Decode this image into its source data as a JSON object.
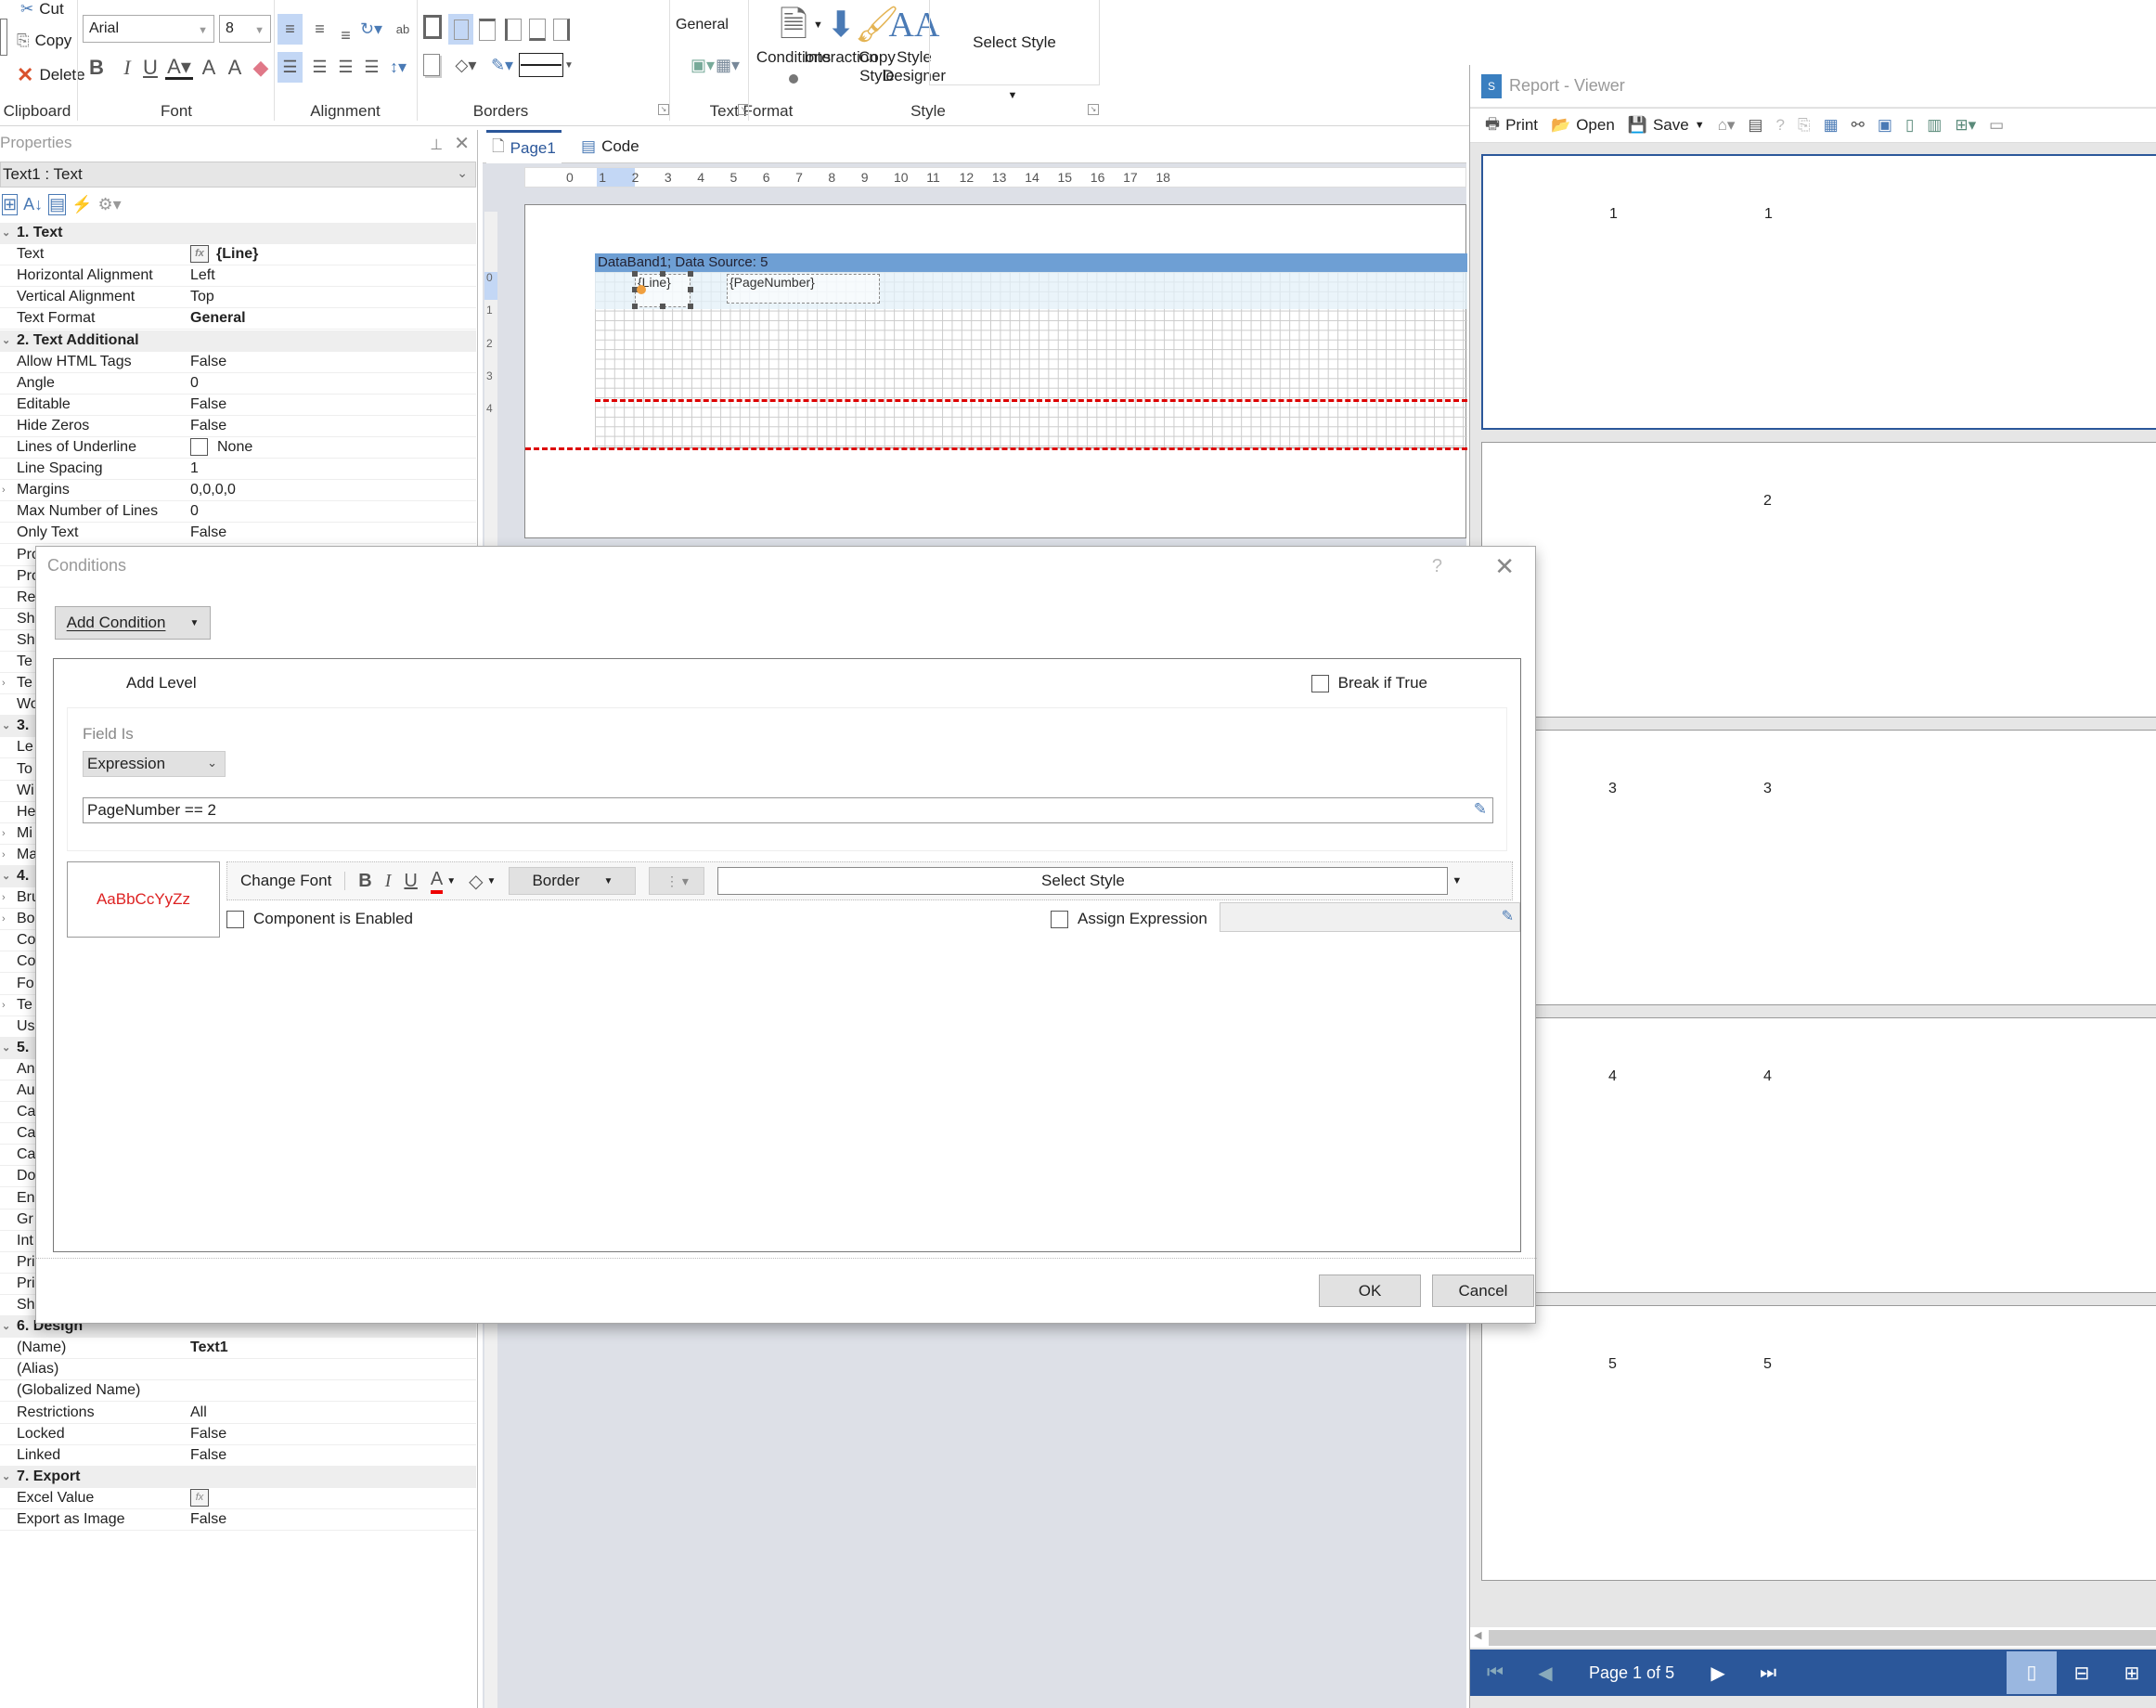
{
  "ribbon": {
    "clipboard": {
      "label": "Clipboard",
      "cut": "Cut",
      "copy": "Copy",
      "delete": "Delete"
    },
    "font": {
      "label": "Font",
      "family": "Arial",
      "size": "8"
    },
    "alignment": {
      "label": "Alignment"
    },
    "borders": {
      "label": "Borders"
    },
    "text_format": {
      "label": "Text Format",
      "value": "General"
    },
    "style": {
      "label": "Style",
      "conditions": "Conditions",
      "interaction": "Interaction",
      "copy_style": "Copy Style",
      "style_designer": "Style Designer",
      "select_style": "Select Style"
    }
  },
  "properties": {
    "title": "Properties",
    "object": "Text1 : Text",
    "rows_top": [
      {
        "type": "cat",
        "k": "1. Text"
      },
      {
        "k": "Text",
        "v": "{Line}",
        "fx": true,
        "bold": true
      },
      {
        "k": "Horizontal Alignment",
        "v": "Left"
      },
      {
        "k": "Vertical Alignment",
        "v": "Top"
      },
      {
        "k": "Text Format",
        "v": "General",
        "bold": true
      },
      {
        "type": "cat",
        "k": "2. Text  Additional"
      },
      {
        "k": "Allow HTML Tags",
        "v": "False"
      },
      {
        "k": "Angle",
        "v": "0"
      },
      {
        "k": "Editable",
        "v": "False"
      },
      {
        "k": "Hide Zeros",
        "v": "False"
      },
      {
        "k": "Lines of Underline",
        "v": "None",
        "check": true
      },
      {
        "k": "Line Spacing",
        "v": "1"
      },
      {
        "k": "Margins",
        "v": "0,0,0,0",
        "exp": true
      },
      {
        "k": "Max Number of Lines",
        "v": "0"
      },
      {
        "k": "Only Text",
        "v": "False"
      },
      {
        "k": "Pro",
        "v": ""
      },
      {
        "k": "Pro",
        "v": ""
      },
      {
        "k": "Re",
        "v": ""
      },
      {
        "k": "Sh",
        "v": ""
      },
      {
        "k": "Sh",
        "v": ""
      },
      {
        "k": "Te",
        "v": ""
      },
      {
        "k": "Te",
        "v": "",
        "exp": true
      },
      {
        "k": "Wo",
        "v": ""
      },
      {
        "type": "cat",
        "k": "3."
      },
      {
        "k": "Le",
        "v": ""
      },
      {
        "k": "To",
        "v": ""
      },
      {
        "k": "Wi",
        "v": ""
      },
      {
        "k": "He",
        "v": ""
      },
      {
        "k": "Mi",
        "v": "",
        "exp": true
      },
      {
        "k": "Ma",
        "v": "",
        "exp": true
      },
      {
        "type": "cat",
        "k": "4."
      },
      {
        "k": "Bru",
        "v": "",
        "exp": true
      },
      {
        "k": "Bo",
        "v": "",
        "exp": true
      },
      {
        "k": "Co",
        "v": ""
      },
      {
        "k": "Co",
        "v": ""
      },
      {
        "k": "Fo",
        "v": ""
      },
      {
        "k": "Te",
        "v": "",
        "exp": true
      },
      {
        "k": "Us",
        "v": ""
      },
      {
        "type": "cat",
        "k": "5."
      },
      {
        "k": "An",
        "v": ""
      },
      {
        "k": "Au",
        "v": ""
      },
      {
        "k": "Ca",
        "v": ""
      },
      {
        "k": "Ca",
        "v": ""
      },
      {
        "k": "Ca",
        "v": ""
      },
      {
        "k": "Do",
        "v": ""
      },
      {
        "k": "En",
        "v": ""
      },
      {
        "k": "Gr",
        "v": ""
      },
      {
        "k": "Int",
        "v": ""
      },
      {
        "k": "Pri",
        "v": ""
      },
      {
        "k": "Pri",
        "v": ""
      },
      {
        "k": "Sh",
        "v": ""
      },
      {
        "type": "cat",
        "k": "6. Design"
      },
      {
        "k": "(Name)",
        "v": "Text1",
        "bold": true
      },
      {
        "k": "(Alias)",
        "v": ""
      },
      {
        "k": "(Globalized Name)",
        "v": ""
      },
      {
        "k": "Restrictions",
        "v": "All"
      },
      {
        "k": "Locked",
        "v": "False"
      },
      {
        "k": "Linked",
        "v": "False"
      },
      {
        "type": "cat",
        "k": "7. Export"
      },
      {
        "k": "Excel Value",
        "v": "",
        "fx": true
      },
      {
        "k": "Export as Image",
        "v": "False"
      }
    ]
  },
  "designer": {
    "tabs": [
      {
        "label": "Page1"
      },
      {
        "label": "Code"
      }
    ],
    "ruler": [
      "0",
      "1",
      "2",
      "3",
      "4",
      "5",
      "6",
      "7",
      "8",
      "9",
      "10",
      "11",
      "12",
      "13",
      "14",
      "15",
      "16",
      "17",
      "18"
    ],
    "vruler": [
      "0",
      "1",
      "2",
      "3",
      "4"
    ],
    "band_title": "DataBand1; Data Source: 5",
    "comp_line": "{Line}",
    "comp_page": "{PageNumber}"
  },
  "viewer": {
    "title": "Report - Viewer",
    "toolbar": {
      "print": "Print",
      "open": "Open",
      "save": "Save"
    },
    "pages": [
      {
        "line": "1",
        "page": "1"
      },
      {
        "line": "",
        "page": "2"
      },
      {
        "line": "3",
        "page": "3"
      },
      {
        "line": "4",
        "page": "4"
      },
      {
        "line": "5",
        "page": "5"
      }
    ],
    "page_info": "Page 1 of 5"
  },
  "dialog": {
    "title": "Conditions",
    "help": "?",
    "add_condition": "Add Condition",
    "add_level": "Add Level",
    "break_if_true": "Break if True",
    "field_is": "Field Is",
    "field_type": "Expression",
    "expression": "PageNumber == 2",
    "preview": "AaBbCcYyZz",
    "preview_color": "#dd2222",
    "change_font": "Change Font",
    "border": "Border",
    "select_style": "Select Style",
    "component_enabled": "Component is Enabled",
    "assign_expression": "Assign Expression",
    "ok": "OK",
    "cancel": "Cancel"
  }
}
